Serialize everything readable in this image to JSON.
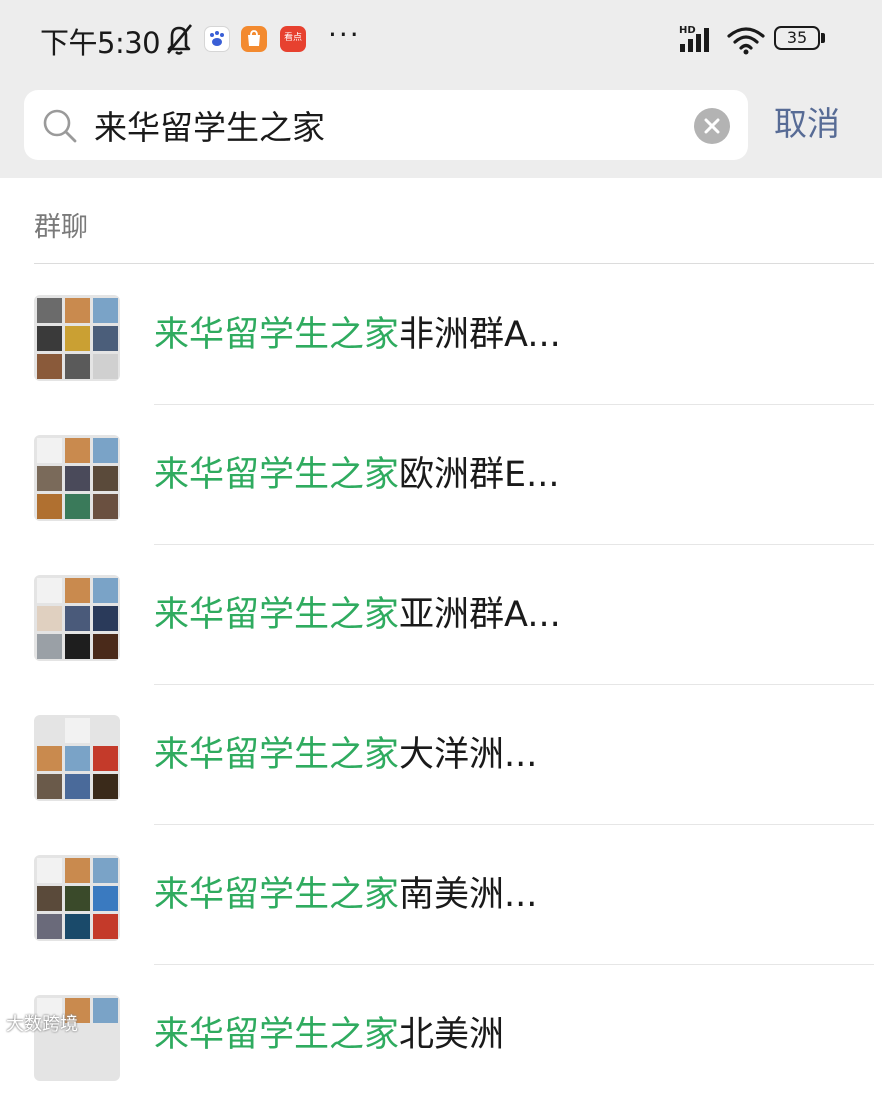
{
  "status_bar": {
    "time": "下午5:30",
    "icons": [
      "bell-off-icon",
      "baidu-app-icon",
      "taobao-app-icon",
      "kandian-app-icon"
    ],
    "kandian_label": "看点",
    "more": "···",
    "network_label": "HD",
    "battery": "35"
  },
  "search": {
    "query": "来华留学生之家",
    "cancel_label": "取消"
  },
  "section": {
    "title": "群聊"
  },
  "results": [
    {
      "highlight": "来华留学生之家",
      "rest": "非洲群A..."
    },
    {
      "highlight": "来华留学生之家",
      "rest": "欧洲群E..."
    },
    {
      "highlight": "来华留学生之家",
      "rest": "亚洲群A..."
    },
    {
      "highlight": "来华留学生之家",
      "rest": "大洋洲..."
    },
    {
      "highlight": "来华留学生之家",
      "rest": "南美洲..."
    },
    {
      "highlight": "来华留学生之家",
      "rest": "北美洲"
    }
  ],
  "watermark": "大数跨境",
  "colors": {
    "highlight": "#2fab5f",
    "cancel": "#576b95",
    "header_bg": "#ededed"
  }
}
